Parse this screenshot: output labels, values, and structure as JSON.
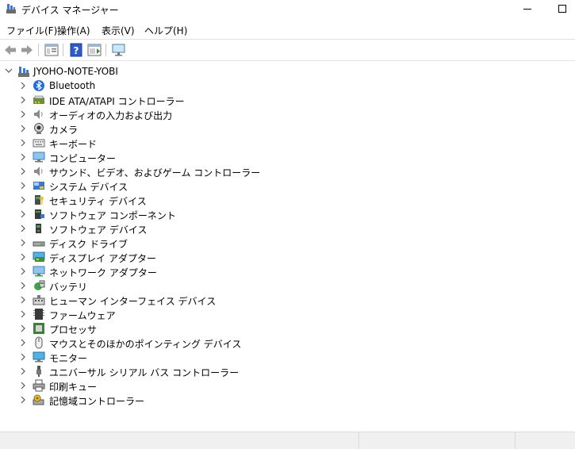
{
  "window": {
    "title": "デバイス マネージャー"
  },
  "menu": {
    "file": "ファイル(F)",
    "action": "操作(A)",
    "view": "表示(V)",
    "help": "ヘルプ(H)"
  },
  "tree": {
    "root": "JYOHO-NOTE-YOBI",
    "items": [
      {
        "label": "Bluetooth",
        "icon": "bluetooth-icon"
      },
      {
        "label": "IDE ATA/ATAPI コントローラー",
        "icon": "ide-controller-icon"
      },
      {
        "label": "オーディオの入力および出力",
        "icon": "speaker-icon"
      },
      {
        "label": "カメラ",
        "icon": "camera-icon"
      },
      {
        "label": "キーボード",
        "icon": "keyboard-icon"
      },
      {
        "label": "コンピューター",
        "icon": "computer-icon"
      },
      {
        "label": "サウンド、ビデオ、およびゲーム コントローラー",
        "icon": "speaker-icon"
      },
      {
        "label": "システム デバイス",
        "icon": "system-devices-icon"
      },
      {
        "label": "セキュリティ デバイス",
        "icon": "security-device-icon"
      },
      {
        "label": "ソフトウェア コンポーネント",
        "icon": "software-component-icon"
      },
      {
        "label": "ソフトウェア デバイス",
        "icon": "software-device-icon"
      },
      {
        "label": "ディスク ドライブ",
        "icon": "disk-drive-icon"
      },
      {
        "label": "ディスプレイ アダプター",
        "icon": "display-adapter-icon"
      },
      {
        "label": "ネットワーク アダプター",
        "icon": "network-adapter-icon"
      },
      {
        "label": "バッテリ",
        "icon": "battery-icon"
      },
      {
        "label": "ヒューマン インターフェイス デバイス",
        "icon": "hid-icon"
      },
      {
        "label": "ファームウェア",
        "icon": "firmware-icon"
      },
      {
        "label": "プロセッサ",
        "icon": "processor-icon"
      },
      {
        "label": "マウスとそのほかのポインティング デバイス",
        "icon": "mouse-icon"
      },
      {
        "label": "モニター",
        "icon": "monitor-icon"
      },
      {
        "label": "ユニバーサル シリアル バス コントローラー",
        "icon": "usb-icon"
      },
      {
        "label": "印刷キュー",
        "icon": "printer-icon"
      },
      {
        "label": "記憶域コントローラー",
        "icon": "storage-controller-icon"
      }
    ]
  }
}
